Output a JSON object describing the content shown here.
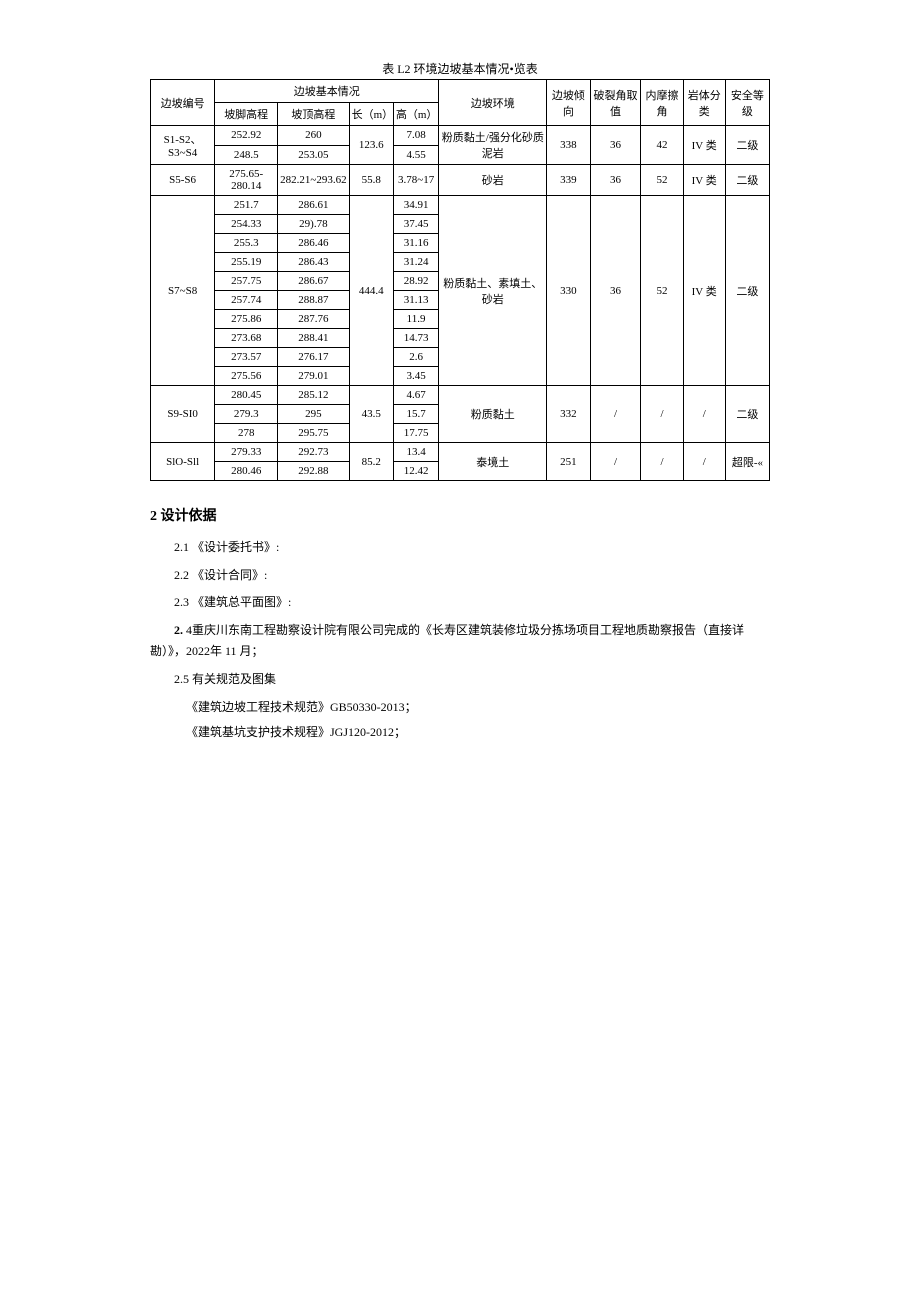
{
  "table": {
    "caption": "表 L2 环境边坡基本情况•览表",
    "headers": {
      "slope_no": "边坡编号",
      "basic_group": "边坡基本情况",
      "foot_elev": "坡脚高程",
      "top_elev": "坡顶高程",
      "length": "长（m）",
      "height": "高（m）",
      "env": "边坡环境",
      "dip": "边坡倾向",
      "crack_angle": "破裂角取值",
      "friction": "内摩擦角",
      "rock_class": "岩体分类",
      "safety": "安全等级"
    },
    "groups": [
      {
        "slope_no": "S1-S2、S3~S4",
        "length": "123.6",
        "env": "粉质黏土/强分化砂质泥岩",
        "dip": "338",
        "crack": "36",
        "fric": "42",
        "rock": "IV 类",
        "safety": "二级",
        "rows": [
          {
            "foot": "252.92",
            "top": "260",
            "height": "7.08"
          },
          {
            "foot": "248.5",
            "top": "253.05",
            "height": "4.55"
          }
        ]
      },
      {
        "slope_no": "S5-S6",
        "length": "55.8",
        "env": "砂岩",
        "dip": "339",
        "crack": "36",
        "fric": "52",
        "rock": "IV 类",
        "safety": "二级",
        "rows": [
          {
            "foot": "275.65-280.14",
            "top": "282.21~293.62",
            "height": "3.78~17"
          }
        ]
      },
      {
        "slope_no": "S7~S8",
        "length": "444.4",
        "env": "粉质黏土、素填土、砂岩",
        "dip": "330",
        "crack": "36",
        "fric": "52",
        "rock": "IV 类",
        "safety": "二级",
        "rows": [
          {
            "foot": "251.7",
            "top": "286.61",
            "height": "34.91"
          },
          {
            "foot": "254.33",
            "top": "29).78",
            "height": "37.45"
          },
          {
            "foot": "255.3",
            "top": "286.46",
            "height": "31.16"
          },
          {
            "foot": "255.19",
            "top": "286.43",
            "height": "31.24"
          },
          {
            "foot": "257.75",
            "top": "286.67",
            "height": "28.92"
          },
          {
            "foot": "257.74",
            "top": "288.87",
            "height": "31.13"
          },
          {
            "foot": "275.86",
            "top": "287.76",
            "height": "11.9"
          },
          {
            "foot": "273.68",
            "top": "288.41",
            "height": "14.73"
          },
          {
            "foot": "273.57",
            "top": "276.17",
            "height": "2.6"
          },
          {
            "foot": "275.56",
            "top": "279.01",
            "height": "3.45"
          }
        ]
      },
      {
        "slope_no": "S9-SI0",
        "length": "43.5",
        "env": "粉质黏土",
        "dip": "332",
        "crack": "/",
        "fric": "/",
        "rock": "/",
        "safety": "二级",
        "rows": [
          {
            "foot": "280.45",
            "top": "285.12",
            "height": "4.67"
          },
          {
            "foot": "279.3",
            "top": "295",
            "height": "15.7"
          },
          {
            "foot": "278",
            "top": "295.75",
            "height": "17.75"
          }
        ]
      },
      {
        "slope_no": "SlO-Sll",
        "length": "85.2",
        "env": "泰境土",
        "dip": "251",
        "crack": "/",
        "fric": "/",
        "rock": "/",
        "safety": "超限-«",
        "rows": [
          {
            "foot": "279.33",
            "top": "292.73",
            "height": "13.4"
          },
          {
            "foot": "280.46",
            "top": "292.88",
            "height": "12.42"
          }
        ]
      }
    ]
  },
  "section2": {
    "title": "2 设计依据",
    "items": {
      "i21": "2.1 《设计委托书》:",
      "i22": "2.2 《设计合同》:",
      "i23": "2.3 《建筑总平面图》:",
      "i24_num": "2.",
      "i24_rest": " 4重庆川东南工程勘察设计院有限公司完成的《长寿区建筑装修垃圾分拣场项目工程地质勘察报告（直接详勘）》，2022年 11 月；",
      "i25": "2.5 有关规范及图集",
      "s1": "《建筑边坡工程技术规范》GB50330-2013；",
      "s2": "《建筑基坑支护技术规程》JGJ120-2012；"
    }
  }
}
